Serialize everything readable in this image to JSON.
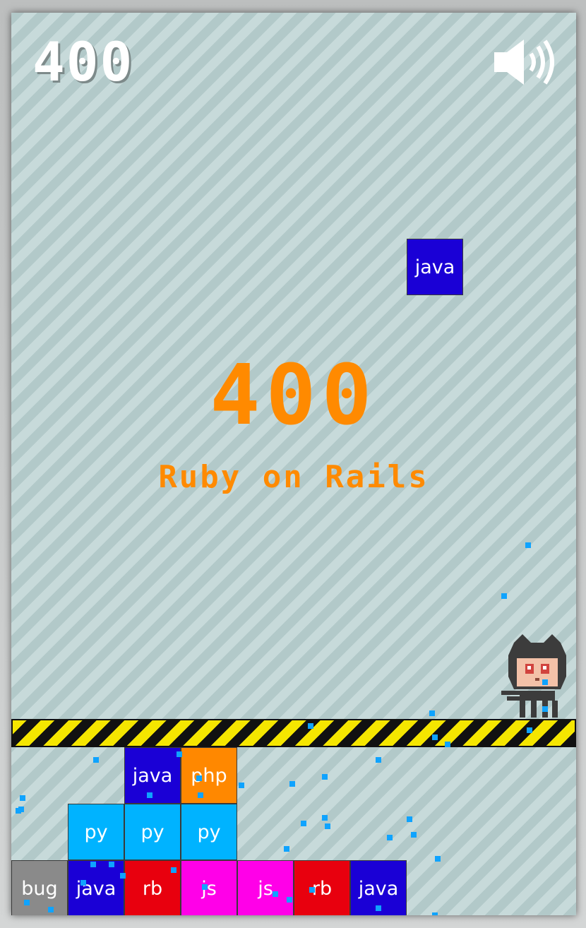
{
  "hud": {
    "score": "400",
    "sound_icon": "speaker-on-icon"
  },
  "popup": {
    "score": "400",
    "language": "Ruby on Rails"
  },
  "falling_block": {
    "label": "java",
    "color": "#1a00d6"
  },
  "colors": {
    "java": "#1a00d6",
    "php": "#ff8800",
    "py": "#00b3ff",
    "bug": "#8a8a8a",
    "rb": "#e8000e",
    "js": "#ff00e8",
    "popup_text": "#ff8a00",
    "hazard_yellow": "#f5e600",
    "particle": "#0fa3ff"
  },
  "stack": {
    "row1": [
      {
        "label": "bug",
        "color": "#8a8a8a"
      },
      {
        "label": "java",
        "color": "#1a00d6"
      },
      {
        "label": "rb",
        "color": "#e8000e"
      },
      {
        "label": "js",
        "color": "#ff00e8"
      },
      {
        "label": "js",
        "color": "#ff00e8"
      },
      {
        "label": "rb",
        "color": "#e8000e"
      },
      {
        "label": "java",
        "color": "#1a00d6"
      }
    ],
    "row2": [
      {
        "label": "py",
        "color": "#00b3ff"
      },
      {
        "label": "py",
        "color": "#00b3ff"
      },
      {
        "label": "py",
        "color": "#00b3ff"
      }
    ],
    "row3": [
      {
        "label": "java",
        "color": "#1a00d6"
      },
      {
        "label": "php",
        "color": "#ff8800"
      }
    ]
  },
  "player": {
    "icon": "octocat-mascot-icon"
  }
}
